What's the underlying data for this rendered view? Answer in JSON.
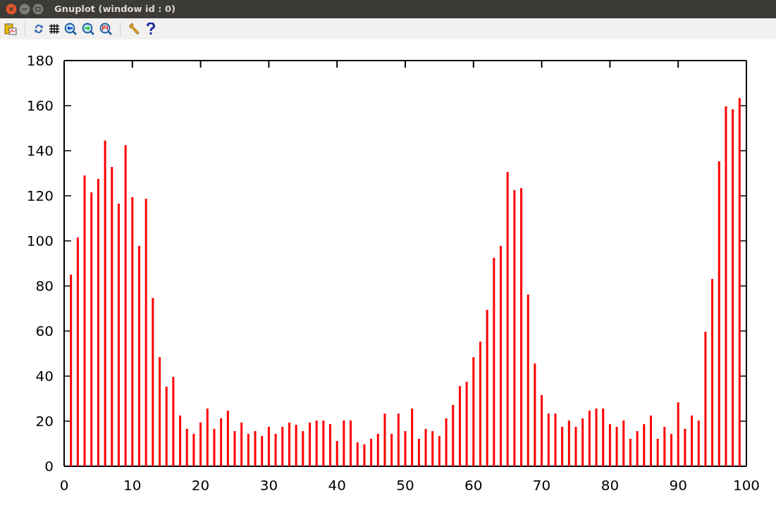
{
  "window": {
    "title": "Gnuplot (window id : 0)"
  },
  "plot": {
    "chart_data": {
      "type": "bar",
      "x": [
        1,
        2,
        3,
        4,
        5,
        6,
        7,
        8,
        9,
        10,
        11,
        12,
        13,
        14,
        15,
        16,
        17,
        18,
        19,
        20,
        21,
        22,
        23,
        24,
        25,
        26,
        27,
        28,
        29,
        30,
        31,
        32,
        33,
        34,
        35,
        36,
        37,
        38,
        39,
        40,
        41,
        42,
        43,
        44,
        45,
        46,
        47,
        48,
        49,
        50,
        51,
        52,
        53,
        54,
        55,
        56,
        57,
        58,
        59,
        60,
        61,
        62,
        63,
        64,
        65,
        66,
        67,
        68,
        69,
        70,
        71,
        72,
        73,
        74,
        75,
        76,
        77,
        78,
        79,
        80,
        81,
        82,
        83,
        84,
        85,
        86,
        87,
        88,
        89,
        90,
        91,
        92,
        93,
        94,
        95,
        96,
        97,
        98,
        99
      ],
      "series": [
        {
          "color": "#ff0000",
          "values": [
            85,
            101.5,
            129,
            121.5,
            127.5,
            144.5,
            132.8,
            116.5,
            142.5,
            119.4,
            97.8,
            118.7,
            74.7,
            48.4,
            35.3,
            39.7,
            22.5,
            16.6,
            14.4,
            19.4,
            25.6,
            16.6,
            21.3,
            24.7,
            15.6,
            19.4,
            14.4,
            15.6,
            13.4,
            17.5,
            14.4,
            17.5,
            19.4,
            18.4,
            15.6,
            19.4,
            20.3,
            20.3,
            18.7,
            11.2,
            20.3,
            20.3,
            10.6,
            9.7,
            12.2,
            14.4,
            23.4,
            14.4,
            23.4,
            15.6,
            25.6,
            12.2,
            16.6,
            15.6,
            13.4,
            21.3,
            27.2,
            35.6,
            37.5,
            48.4,
            55.3,
            69.4,
            92.5,
            97.8,
            130.6,
            122.5,
            123.4,
            76.2,
            45.6,
            31.6,
            23.4,
            23.4,
            17.5,
            20.3,
            17.5,
            21.2,
            24.7,
            25.6,
            25.6,
            18.7,
            17.5,
            20.3,
            12.2,
            15.6,
            18.7,
            22.5,
            12.2,
            17.5,
            14.4,
            28.4,
            16.6,
            22.5,
            20.3,
            59.7,
            83.1,
            135.3,
            159.7,
            158.4,
            163.4
          ]
        }
      ],
      "xlim": [
        0,
        100
      ],
      "ylim": [
        0,
        180
      ],
      "xticks": [
        0,
        10,
        20,
        30,
        40,
        50,
        60,
        70,
        80,
        90,
        100
      ],
      "yticks": [
        0,
        20,
        40,
        60,
        80,
        100,
        120,
        140,
        160,
        180
      ]
    }
  }
}
